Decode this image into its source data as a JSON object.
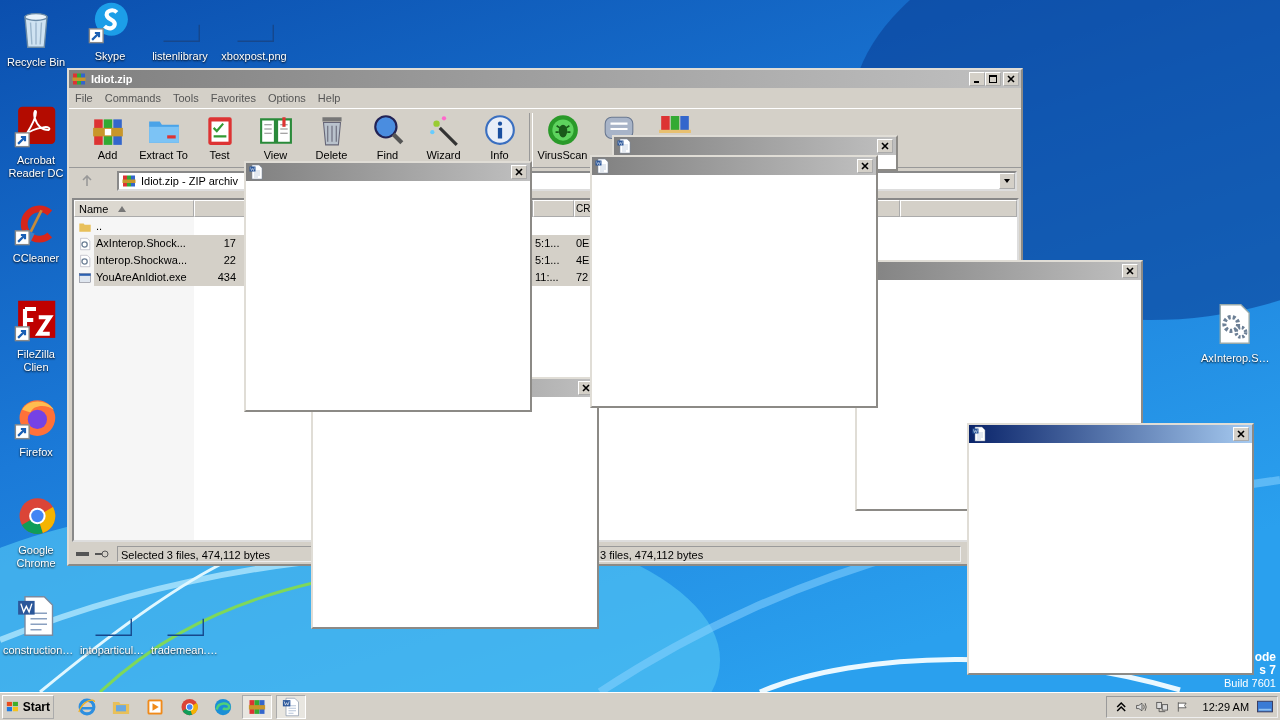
{
  "desktop_icons": [
    {
      "label": "Recycle Bin",
      "kind": "recycle"
    },
    {
      "label": "Skype",
      "kind": "skype"
    },
    {
      "label": "listenlibrary",
      "kind": "blank"
    },
    {
      "label": "xboxpost.png",
      "kind": "blank"
    },
    {
      "label": "Acrobat Reader DC",
      "kind": "acrobat"
    },
    {
      "label": "CCleaner",
      "kind": "ccleaner"
    },
    {
      "label": "FileZilla Clien",
      "kind": "filezilla"
    },
    {
      "label": "Firefox",
      "kind": "firefox"
    },
    {
      "label": "Google Chrome",
      "kind": "chrome"
    },
    {
      "label": "construction…",
      "kind": "word"
    },
    {
      "label": "intoparticul…",
      "kind": "blank"
    },
    {
      "label": "trademean.…",
      "kind": "blank"
    },
    {
      "label": "AxInterop.S…",
      "kind": "gears"
    }
  ],
  "test_mode_notice": [
    "ode",
    "s 7",
    "Build 7601"
  ],
  "archive_window": {
    "title": "Idiot.zip",
    "menu": [
      "File",
      "Commands",
      "Tools",
      "Favorites",
      "Options",
      "Help"
    ],
    "toolbar": [
      {
        "label": "Add",
        "kind": "add"
      },
      {
        "label": "Extract To",
        "kind": "extract"
      },
      {
        "label": "Test",
        "kind": "test"
      },
      {
        "label": "View",
        "kind": "view"
      },
      {
        "label": "Delete",
        "kind": "delete"
      },
      {
        "label": "Find",
        "kind": "find"
      },
      {
        "label": "Wizard",
        "kind": "wizard"
      },
      {
        "label": "Info",
        "kind": "info"
      },
      {
        "label": "VirusScan",
        "kind": "virus"
      },
      {
        "kind": "comment"
      },
      {
        "kind": "sfx"
      }
    ],
    "address": "Idiot.zip - ZIP archiv",
    "columns": [
      {
        "label": "Name",
        "sorted": true
      },
      {
        "label": "CR"
      }
    ],
    "rows": [
      {
        "name": "..",
        "kind": "folder",
        "selected": false
      },
      {
        "name": "AxInterop.Shock...",
        "size": "17",
        "modified": "5:1...",
        "crc": "0E",
        "kind": "dll",
        "selected": true
      },
      {
        "name": "Interop.Shockwa...",
        "size": "22",
        "modified": "5:1...",
        "crc": "4E",
        "kind": "dll",
        "selected": true
      },
      {
        "name": "YouAreAnIdiot.exe",
        "size": "434",
        "modified": "11:...",
        "crc": "72",
        "kind": "exe",
        "selected": true
      }
    ],
    "status": [
      "Selected 3 files, 474,112 bytes",
      "3 files, 474,112 bytes"
    ]
  },
  "popups": [
    {
      "active": false
    },
    {
      "active": false
    },
    {
      "active": false
    },
    {
      "active": false
    },
    {
      "active": false
    },
    {
      "active": true
    }
  ],
  "taskbar": {
    "start": "Start",
    "apps": [
      {
        "kind": "ie",
        "open": false
      },
      {
        "kind": "explorer",
        "open": false
      },
      {
        "kind": "media",
        "open": false
      },
      {
        "kind": "chrome",
        "open": false
      },
      {
        "kind": "edge",
        "open": false
      },
      {
        "kind": "winrar",
        "open": true
      },
      {
        "kind": "word",
        "open": true
      }
    ],
    "clock": "12:29 AM"
  }
}
